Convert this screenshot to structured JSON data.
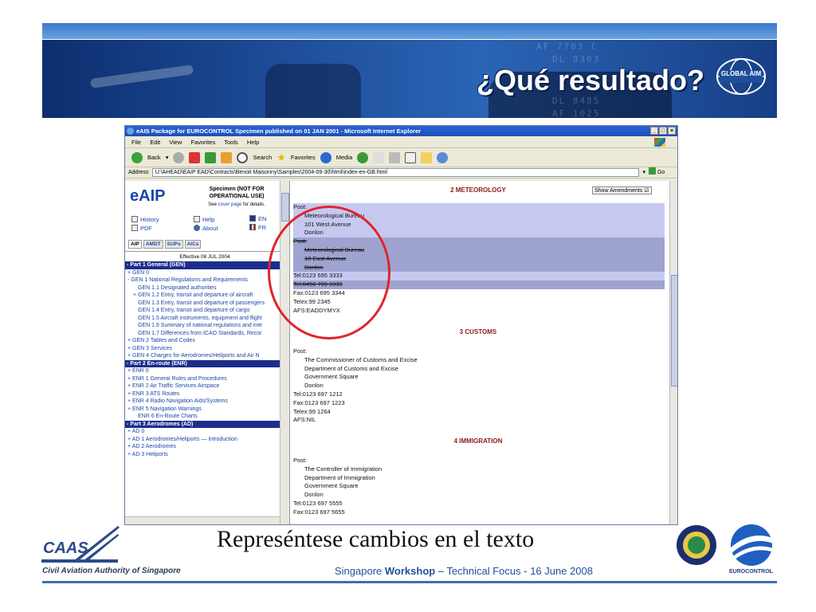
{
  "slide": {
    "title": "¿Qué resultado?",
    "subtitle": "Represéntese cambios en el texto",
    "footer": {
      "prefix": "Singapore ",
      "bold": "Workshop",
      "suffix": " – Technical Focus - 16 June 2008"
    },
    "caas_logo_text": "CAAS",
    "caas_name": "Civil Aviation Authority of Singapore",
    "global_aim_text": "GLOBAL AIM",
    "eurocontrol_text": "EUROCONTROL",
    "colors": {
      "banner": "#1f4f9c",
      "circle": "#e0242b",
      "footer_text": "#1f4f9c"
    }
  },
  "browser": {
    "title": "eAIS Package for EUROCONTROL Specimen published on 01 JAN 2001 - Microsoft Internet Explorer",
    "menu": [
      "File",
      "Edit",
      "View",
      "Favorites",
      "Tools",
      "Help"
    ],
    "toolbar": {
      "back": "Back",
      "search": "Search",
      "favorites": "Favorites",
      "media": "Media"
    },
    "address_label": "Address",
    "address_value": "U:\\AHEAD\\EAIP EAD\\Contracts\\Benoit Maisonny\\Samples\\2004-09-30\\html\\index-en-GB.html",
    "go_label": "Go"
  },
  "left_pane": {
    "logo": "eAIP",
    "specimen": "Specimen (NOT FOR OPERATIONAL USE)",
    "see_cover": {
      "prefix": "See ",
      "link": "cover page",
      "suffix": " for details."
    },
    "links": {
      "history": "History",
      "help": "Help",
      "en": "EN",
      "pdf": "PDF",
      "about": "About",
      "fr": "FR"
    },
    "tabs": [
      "AIP",
      "AMDT",
      "SUPs",
      "AICs"
    ],
    "effective": "Effective 08 JUL 2004",
    "toc": [
      {
        "type": "part",
        "text": "- Part 1 General (GEN)"
      },
      {
        "type": "l1",
        "text": "+ GEN 0"
      },
      {
        "type": "l1",
        "text": "- GEN 1 National Regulations and Requirements"
      },
      {
        "type": "l2b",
        "text": "GEN 1.1 Designated authorities"
      },
      {
        "type": "l2",
        "text": "+ GEN 1.2 Entry, transit and departure of aircraft"
      },
      {
        "type": "l2b",
        "text": "GEN 1.3 Entry, transit and departure of passengers"
      },
      {
        "type": "l2b",
        "text": "GEN 1.4 Entry, transit and departure of cargo"
      },
      {
        "type": "l2b",
        "text": "GEN 1.5 Aircraft instruments, equipment and flight"
      },
      {
        "type": "l2b",
        "text": "GEN 1.6 Summary of national regulations and inte"
      },
      {
        "type": "l2b",
        "text": "GEN 1.7 Differences from ICAO Standards, Recor"
      },
      {
        "type": "l1",
        "text": "+ GEN 2 Tables and Codes"
      },
      {
        "type": "l1",
        "text": "+ GEN 3 Services"
      },
      {
        "type": "l1",
        "text": "+ GEN 4 Charges for Aerodromes/Heliports and Air N"
      },
      {
        "type": "part",
        "text": "- Part 2 En-route (ENR)"
      },
      {
        "type": "l1",
        "text": "+ ENR 0"
      },
      {
        "type": "l1",
        "text": "+ ENR 1 General Rules and Procedures"
      },
      {
        "type": "l1",
        "text": "+ ENR 2 Air Traffic Services Airspace"
      },
      {
        "type": "l1",
        "text": "+ ENR 3 ATS Routes"
      },
      {
        "type": "l1",
        "text": "+ ENR 4 Radio Navigation Aids/Systems"
      },
      {
        "type": "l1",
        "text": "+ ENR 5 Navigation Warnings"
      },
      {
        "type": "l2b",
        "text": "ENR 6 En-Route Charts"
      },
      {
        "type": "part",
        "text": "- Part 3 Aerodromes (AD)"
      },
      {
        "type": "l1",
        "text": "+ AD 0"
      },
      {
        "type": "l1",
        "text": "+ AD 1 Aerodromes/Heliports — Introduction"
      },
      {
        "type": "l1",
        "text": "+ AD 2 Aerodromes"
      },
      {
        "type": "l1",
        "text": "+ AD 3 Heliports"
      }
    ]
  },
  "right_pane": {
    "show_amendments": "Show Amendments ☑",
    "sections": [
      {
        "title": "2  METEOROLOGY",
        "lines": [
          {
            "text": "Post:",
            "ind": false,
            "style": "new"
          },
          {
            "text": "Meteorological Bureau",
            "ind": true,
            "style": "new"
          },
          {
            "text": "101 West Avenue",
            "ind": true,
            "style": "new"
          },
          {
            "text": "Donlon",
            "ind": true,
            "style": "new"
          },
          {
            "text": "Post:",
            "ind": false,
            "style": "old"
          },
          {
            "text": "Meteorological Bureau",
            "ind": true,
            "style": "old"
          },
          {
            "text": "10 East Avenue",
            "ind": true,
            "style": "old"
          },
          {
            "text": "Donlon",
            "ind": true,
            "style": "old"
          },
          {
            "text": "Tel:0123 695 3333",
            "ind": false,
            "style": "new"
          },
          {
            "text": "Tel:0456 789 3333",
            "ind": false,
            "style": "old"
          },
          {
            "text": "Fax:0123 695 3344",
            "ind": false,
            "style": ""
          },
          {
            "text": "Telex:99 2345",
            "ind": false,
            "style": ""
          },
          {
            "text": "AFS:EADDYMYX",
            "ind": false,
            "style": ""
          }
        ]
      },
      {
        "title": "3  CUSTOMS",
        "lines": [
          {
            "text": "Post:",
            "ind": false,
            "style": ""
          },
          {
            "text": "The Commissioner of Customs and Excise",
            "ind": true,
            "style": ""
          },
          {
            "text": "Department of Customs and Excise",
            "ind": true,
            "style": ""
          },
          {
            "text": "Government Square",
            "ind": true,
            "style": ""
          },
          {
            "text": "Donlon",
            "ind": true,
            "style": ""
          },
          {
            "text": "Tel:0123 697 1212",
            "ind": false,
            "style": ""
          },
          {
            "text": "Fax:0123 697 1223",
            "ind": false,
            "style": ""
          },
          {
            "text": "Telex:99 1264",
            "ind": false,
            "style": ""
          },
          {
            "text": "AFS:NIL",
            "ind": false,
            "style": ""
          }
        ]
      },
      {
        "title": "4  IMMIGRATION",
        "lines": [
          {
            "text": "Post:",
            "ind": false,
            "style": ""
          },
          {
            "text": "The Controller of Immigration",
            "ind": true,
            "style": ""
          },
          {
            "text": "Department of Immigration",
            "ind": true,
            "style": ""
          },
          {
            "text": "Government Square",
            "ind": true,
            "style": ""
          },
          {
            "text": "Donlon",
            "ind": true,
            "style": ""
          },
          {
            "text": "Tel:0123 697 5555",
            "ind": false,
            "style": ""
          },
          {
            "text": "Fax:0123 697 5655",
            "ind": false,
            "style": ""
          }
        ]
      }
    ]
  }
}
